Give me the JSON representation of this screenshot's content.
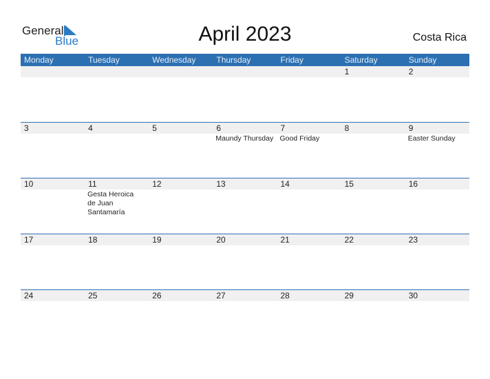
{
  "logo": {
    "general": "General",
    "blue": "Blue"
  },
  "title": "April 2023",
  "country": "Costa Rica",
  "colors": {
    "header": "#2c70b2",
    "date_strip": "#f0f0f0",
    "logo_blue": "#2a7bc4"
  },
  "days": [
    "Monday",
    "Tuesday",
    "Wednesday",
    "Thursday",
    "Friday",
    "Saturday",
    "Sunday"
  ],
  "weeks": [
    [
      {
        "d": ""
      },
      {
        "d": ""
      },
      {
        "d": ""
      },
      {
        "d": ""
      },
      {
        "d": ""
      },
      {
        "d": "1"
      },
      {
        "d": "2"
      }
    ],
    [
      {
        "d": "3"
      },
      {
        "d": "4"
      },
      {
        "d": "5"
      },
      {
        "d": "6",
        "h": "Maundy Thursday"
      },
      {
        "d": "7",
        "h": "Good Friday"
      },
      {
        "d": "8"
      },
      {
        "d": "9",
        "h": "Easter Sunday"
      }
    ],
    [
      {
        "d": "10"
      },
      {
        "d": "11",
        "h": "Gesta Heroica de Juan Santamaría"
      },
      {
        "d": "12"
      },
      {
        "d": "13"
      },
      {
        "d": "14"
      },
      {
        "d": "15"
      },
      {
        "d": "16"
      }
    ],
    [
      {
        "d": "17"
      },
      {
        "d": "18"
      },
      {
        "d": "19"
      },
      {
        "d": "20"
      },
      {
        "d": "21"
      },
      {
        "d": "22"
      },
      {
        "d": "23"
      }
    ],
    [
      {
        "d": "24"
      },
      {
        "d": "25"
      },
      {
        "d": "26"
      },
      {
        "d": "27"
      },
      {
        "d": "28"
      },
      {
        "d": "29"
      },
      {
        "d": "30"
      }
    ]
  ]
}
